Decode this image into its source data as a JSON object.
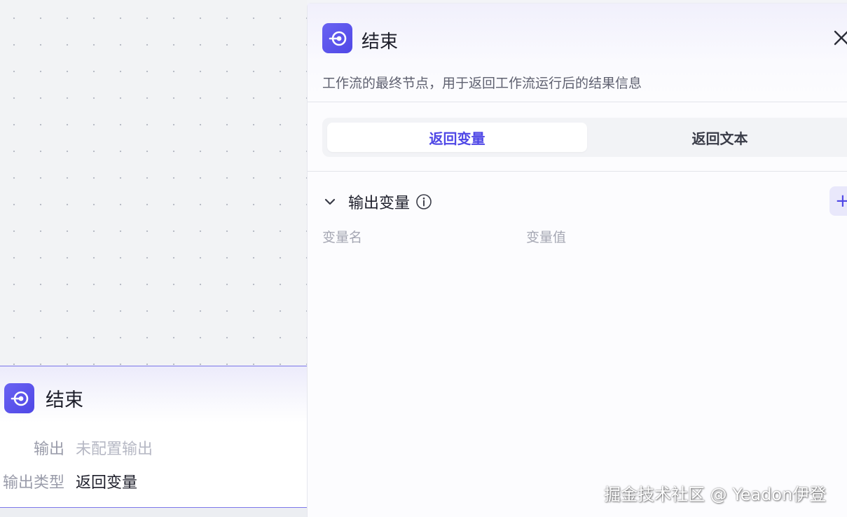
{
  "node": {
    "title": "结束",
    "output_label": "输出",
    "output_value": "未配置输出",
    "output_type_label": "输出类型",
    "output_type_value": "返回变量",
    "icon": "end-node-icon"
  },
  "panel": {
    "title": "结束",
    "description": "工作流的最终节点，用于返回工作流运行后的结果信息",
    "tabs": [
      {
        "label": "返回变量",
        "active": true
      },
      {
        "label": "返回文本",
        "active": false
      }
    ],
    "section": {
      "title": "输出变量",
      "add_label": "+",
      "columns": [
        "变量名",
        "变量值"
      ]
    }
  },
  "watermark": "掘金技术社区 @ Yeadon伊登",
  "colors": {
    "accent": "#4f47e6",
    "node_border": "#7a75e8",
    "canvas_bg": "#f2f3f5"
  }
}
